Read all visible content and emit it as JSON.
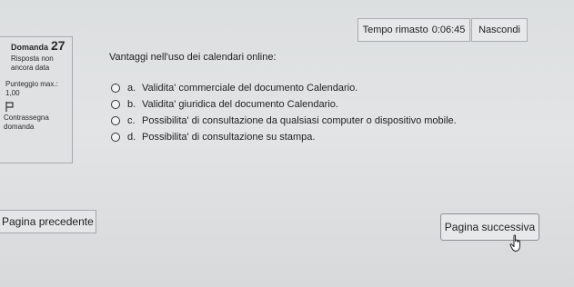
{
  "timer": {
    "label": "Tempo rimasto",
    "value": "0:06:45",
    "hide_label": "Nascondi"
  },
  "question_info": {
    "prefix": "Domanda",
    "number": "27",
    "status": "Risposta non ancora data",
    "score": "Punteggio max.: 1,00",
    "flag_label": "Contrassegna domanda"
  },
  "question": {
    "text": "Vantaggi nell'uso dei calendari online:",
    "answers": [
      {
        "letter": "a.",
        "text": "Validita' commerciale del documento Calendario."
      },
      {
        "letter": "b.",
        "text": "Validita' giuridica del documento Calendario."
      },
      {
        "letter": "c.",
        "text": "Possibilita' di consultazione da qualsiasi computer o dispositivo mobile."
      },
      {
        "letter": "d.",
        "text": "Possibilita' di consultazione su stampa."
      }
    ]
  },
  "nav": {
    "prev_label": "Pagina precedente",
    "next_label": "Pagina successiva"
  }
}
